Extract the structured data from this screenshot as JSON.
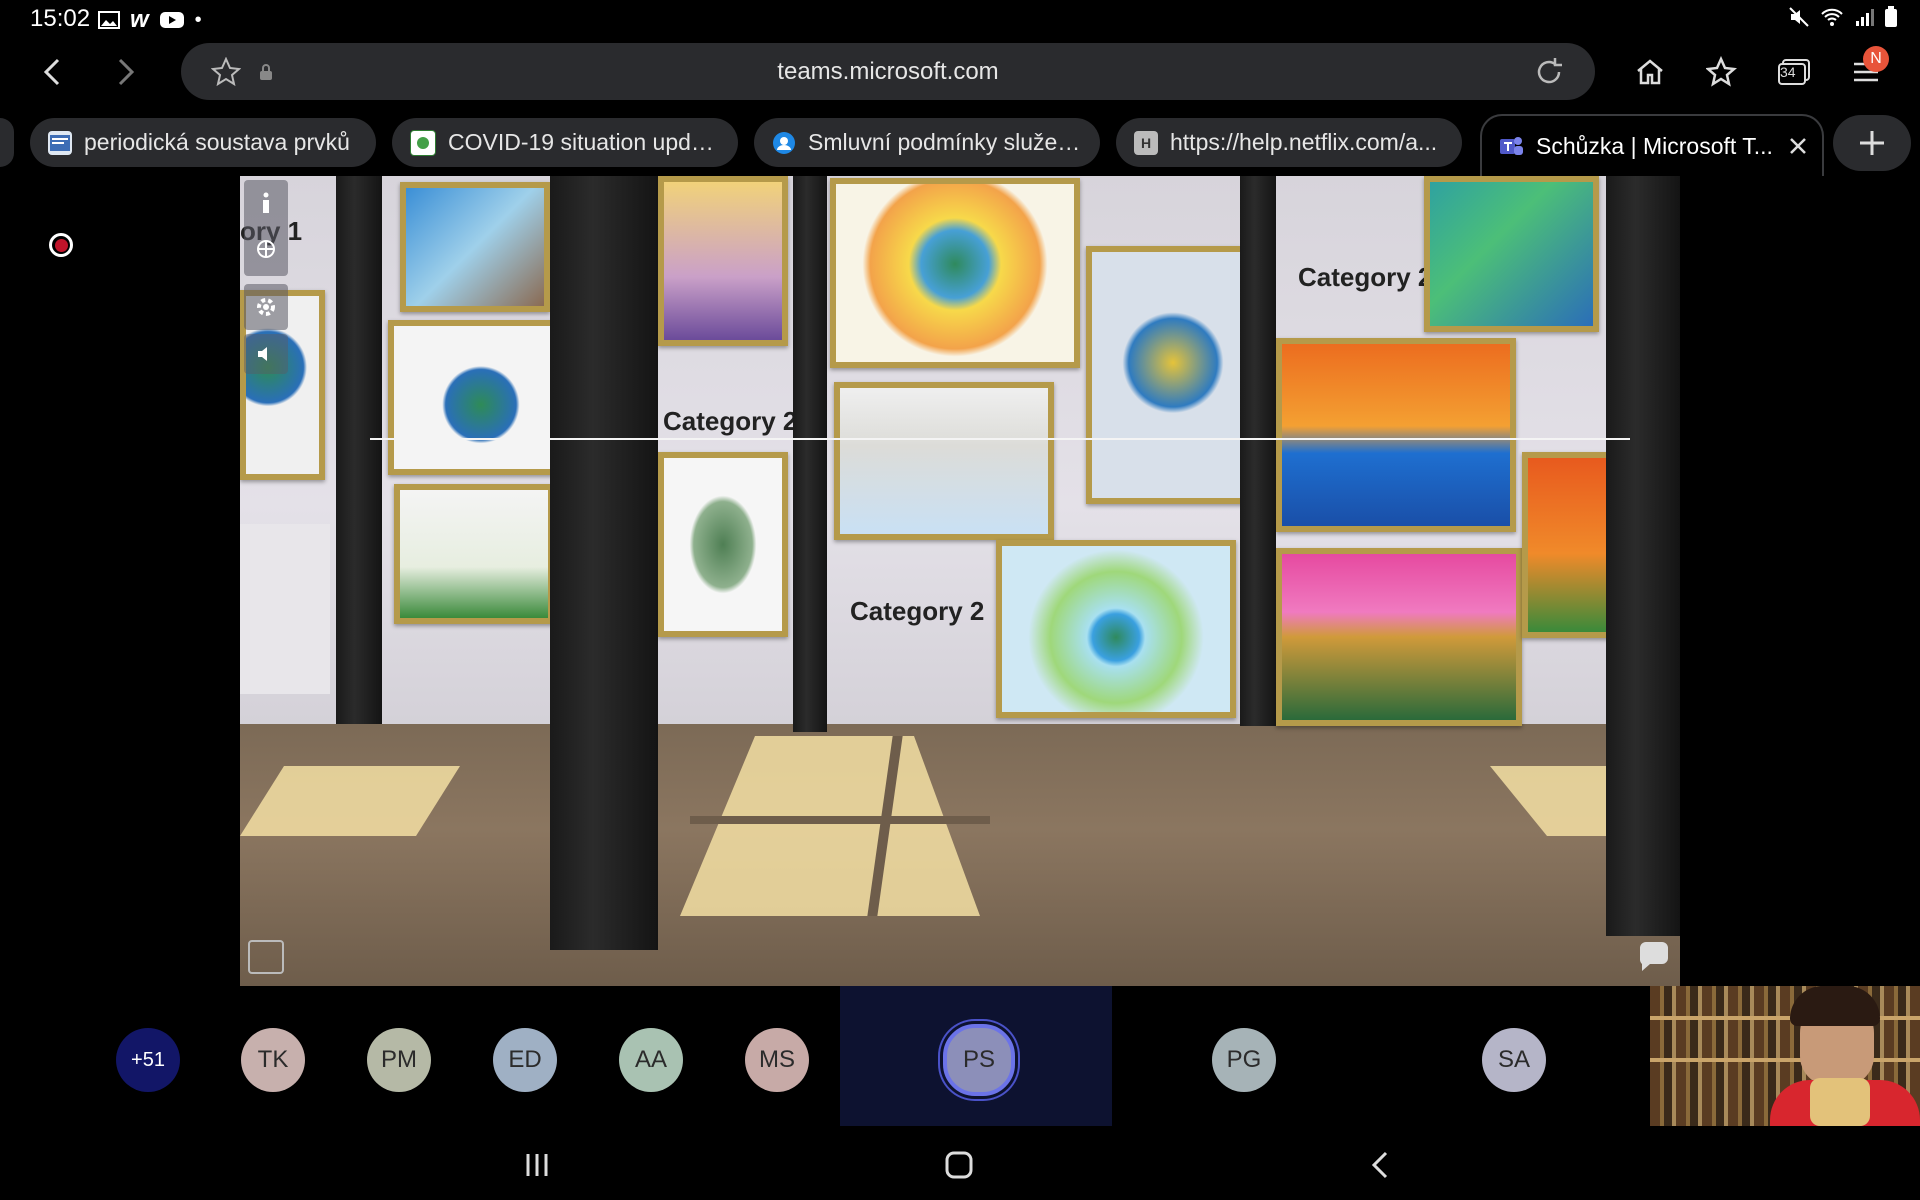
{
  "status_bar": {
    "time": "15:02"
  },
  "browser": {
    "url": "teams.microsoft.com",
    "tab_count": "34",
    "profile_initial": "N",
    "tabs": [
      {
        "label": "periodická soustava prvků"
      },
      {
        "label": "COVID-19 situation updat..."
      },
      {
        "label": "Smluvní podmínky služeb..."
      },
      {
        "label": "https://help.netflix.com/a..."
      }
    ],
    "favicon_letter": "H",
    "active_tab": {
      "label": "Schůzka | Microsoft T..."
    }
  },
  "shared_content": {
    "labels": [
      "ory 1",
      "Category 2",
      "Category 2",
      "Category 2"
    ]
  },
  "participants": {
    "overflow": "+51",
    "list": [
      {
        "initials": "TK",
        "color": "#c7b0ad"
      },
      {
        "initials": "PM",
        "color": "#b5b9a6"
      },
      {
        "initials": "ED",
        "color": "#9fb0c4"
      },
      {
        "initials": "AA",
        "color": "#a9c2b2"
      },
      {
        "initials": "MS",
        "color": "#c7aaa7"
      },
      {
        "initials": "PS",
        "color": "#8c8fb9"
      },
      {
        "initials": "PG",
        "color": "#a6b3b7"
      },
      {
        "initials": "SA",
        "color": "#b5b5c8"
      }
    ]
  },
  "colors": {
    "accent": "#e8543a",
    "recording": "#c0142a",
    "overflow_bg": "#121667"
  }
}
